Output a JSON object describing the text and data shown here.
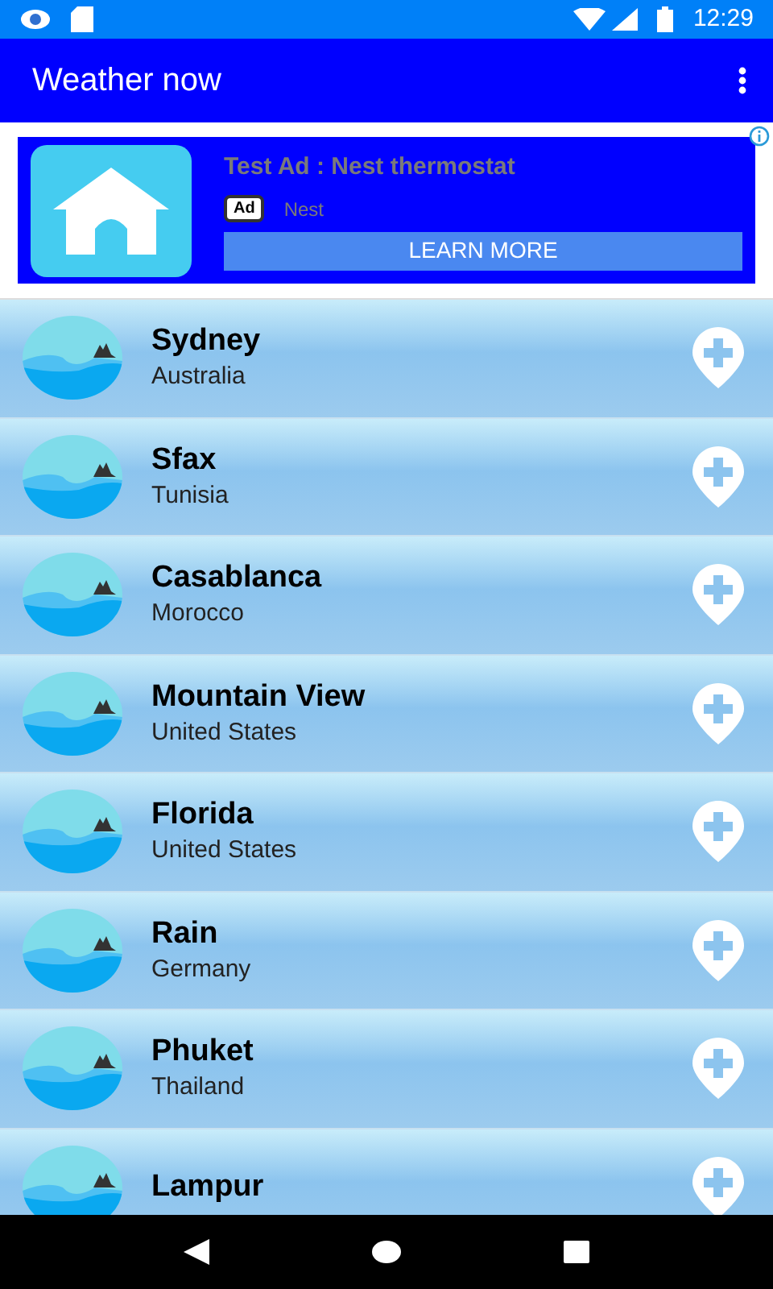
{
  "status_bar": {
    "time": "12:29"
  },
  "app_bar": {
    "title": "Weather now"
  },
  "ad": {
    "title": "Test Ad : Nest thermostat",
    "badge": "Ad",
    "advertiser": "Nest",
    "button": "LEARN MORE"
  },
  "cities": [
    {
      "name": "Sydney",
      "country": "Australia"
    },
    {
      "name": "Sfax",
      "country": "Tunisia"
    },
    {
      "name": "Casablanca",
      "country": "Morocco"
    },
    {
      "name": "Mountain View",
      "country": "United States"
    },
    {
      "name": "Florida",
      "country": "United States"
    },
    {
      "name": "Rain",
      "country": "Germany"
    },
    {
      "name": "Phuket",
      "country": "Thailand"
    },
    {
      "name": "Lampur"
    }
  ]
}
